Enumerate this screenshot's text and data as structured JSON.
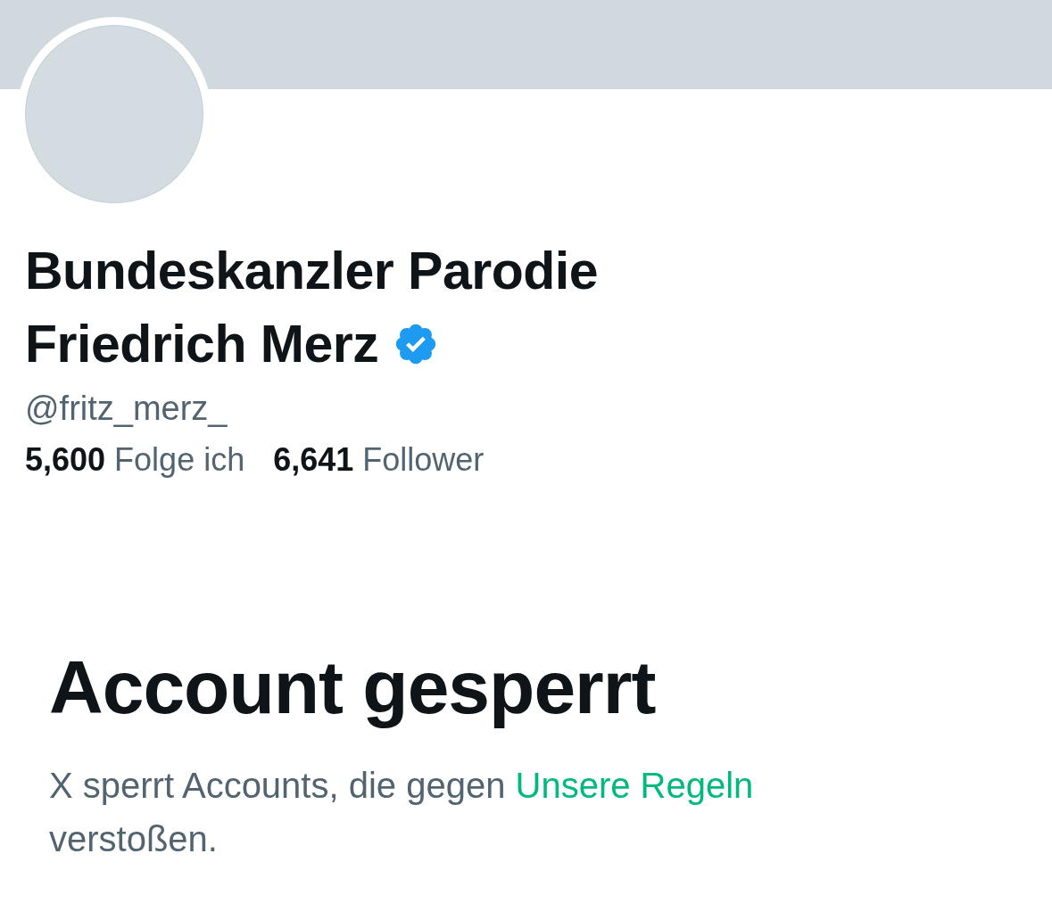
{
  "profile": {
    "name_lines": [
      "Bundeskanzler Parodie",
      "Friedrich Merz"
    ],
    "verified": true,
    "handle": "@fritz_merz_",
    "stats": [
      {
        "count": "5,600",
        "label": "Folge ich"
      },
      {
        "count": "6,641",
        "label": "Follower"
      }
    ]
  },
  "notice": {
    "title": "Account gesperrt",
    "text_before": "X sperrt Accounts, die gegen",
    "link": "Unsere Regeln",
    "text_after": "verstoßen."
  }
}
